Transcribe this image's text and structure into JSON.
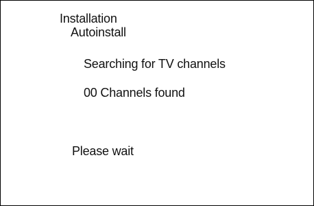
{
  "menu": {
    "title": "Installation",
    "subtitle": "Autoinstall"
  },
  "status": {
    "searching_text": "Searching for TV channels",
    "channels_found_text": "00 Channels found",
    "wait_text": "Please wait"
  }
}
